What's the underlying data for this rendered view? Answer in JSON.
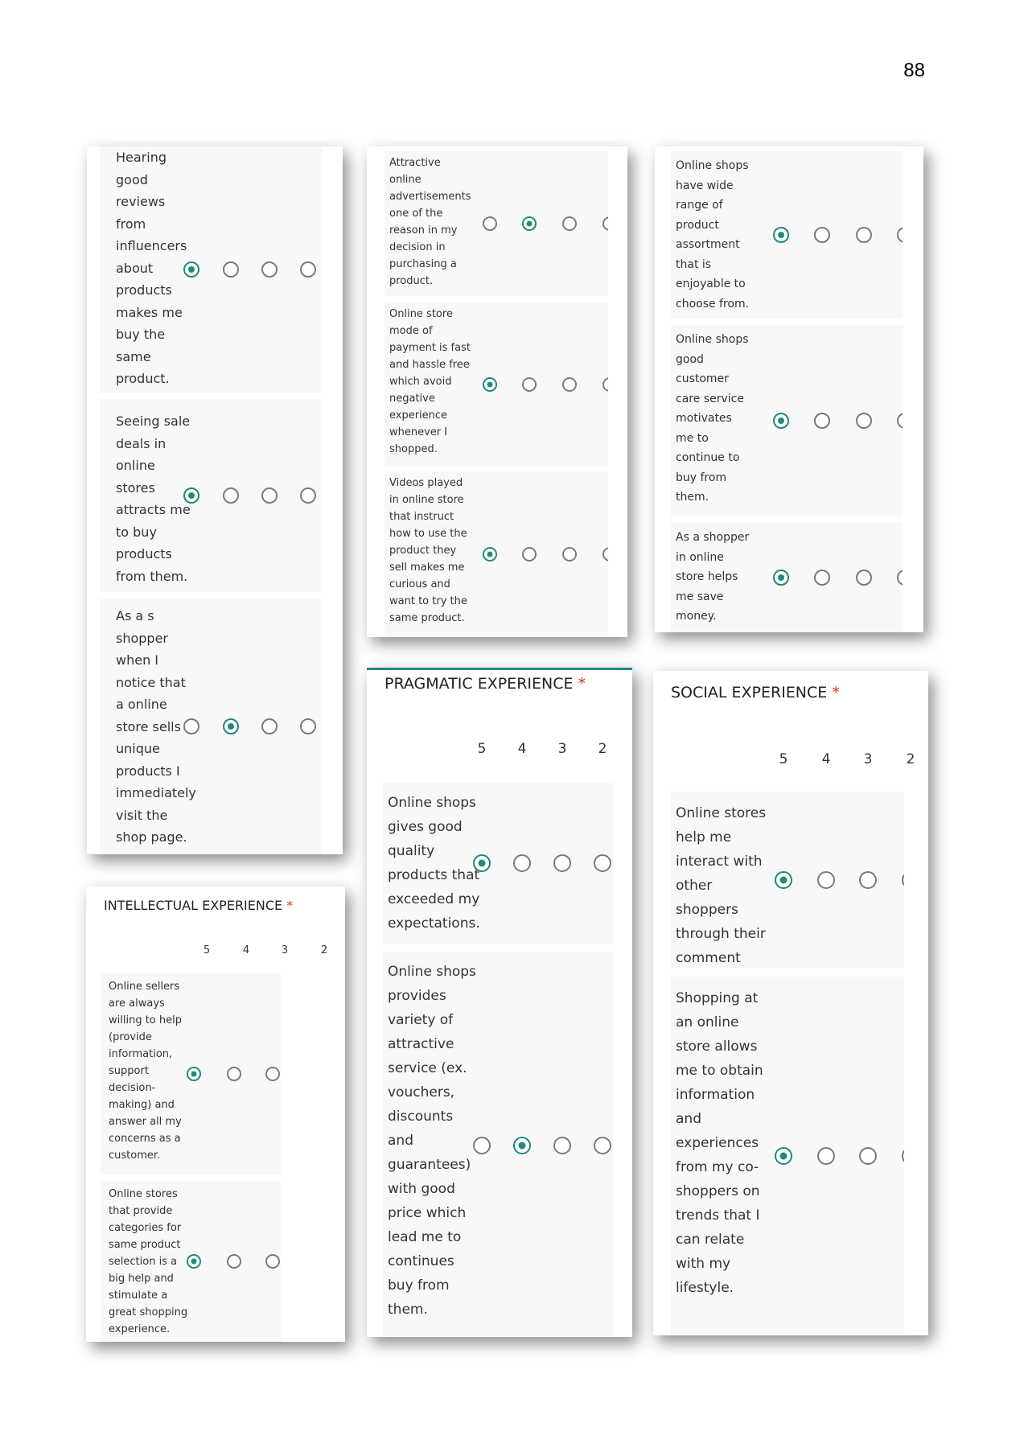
{
  "page_number": "88",
  "required_mark": "*",
  "scale_labels": [
    "5",
    "4",
    "3",
    "2"
  ],
  "sections": {
    "intellectual": {
      "title": "INTELLECTUAL EXPERIENCE"
    },
    "pragmatic": {
      "title": "PRAGMATIC EXPERIENCE"
    },
    "social": {
      "title": "SOCIAL EXPERIENCE"
    }
  },
  "questions": {
    "q1": {
      "text": "Hearing\ngood\nreviews\nfrom\ninfluencers\nabout\nproducts\nmakes me\nbuy the\nsame\nproduct.",
      "selected": "5"
    },
    "q2": {
      "text": "Seeing sale\ndeals in\nonline\nstores\nattracts me\nto buy\nproducts\nfrom them.",
      "selected": "5"
    },
    "q3": {
      "text": "As a s\nshopper\nwhen I\nnotice that\na online\nstore sells a\nunique\nproducts I\nimmediately\nvisit the\nshop page.",
      "selected": "4"
    },
    "q4": {
      "text": "Online sellers\nare always\nwilling to help\n(provide\ninformation,\nsupport\ndecision-\nmaking) and\nanswer all my\nconcerns as a\ncustomer.",
      "selected": "5"
    },
    "q5": {
      "text": "Online stores\nthat provide\ncategories for\nsame product\nselection is a\nbig help and\nstimulate a\ngreat shopping\nexperience.",
      "selected": "5"
    },
    "q6": {
      "text": "Attractive\nonline\nadvertisements\none of the\nreason in my\ndecision in\npurchasing a\nproduct.",
      "selected": "4"
    },
    "q7": {
      "text": "Online store\nmode of\npayment is fast\nand hassle free\nwhich avoid\nnegative\nexperience\nwhenever I\nshopped.",
      "selected": "5"
    },
    "q8": {
      "text": "Videos played\nin online store\nthat instruct\nhow to use the\nproduct they\nsell makes me\ncurious and\nwant to try the\nsame product.",
      "selected": "5"
    },
    "q9": {
      "text": "Online shops\ngives good\nquality\nproducts that\nexceeded my\nexpectations.",
      "selected": "5"
    },
    "q10": {
      "text": "Online shops\nprovides\nvariety of\nattractive\nservice (ex.\nvouchers,\ndiscounts\nand\nguarantees)\nwith good\nprice which\nlead me to\ncontinues\nbuy from\nthem.",
      "selected": "4"
    },
    "q11": {
      "text": "Online shops\nhave wide\nrange of\nproduct\nassortment\nthat is\nenjoyable to\nchoose from.",
      "selected": "5"
    },
    "q12": {
      "text": "Online shops\ngood\ncustomer\ncare service\nmotivates\nme to\ncontinue to\nbuy from\nthem.",
      "selected": "5"
    },
    "q13": {
      "text": "As a shopper\nin online\nstore helps\nme save\nmoney.",
      "selected": "5"
    },
    "q14": {
      "text": "Online stores\nhelp me\ninteract with\nother\nshoppers\nthrough their\ncomment\nsection.",
      "selected": "5"
    },
    "q15": {
      "text": "Shopping at\nan online\nstore allows\nme to obtain\ninformation\nand\nexperiences\nfrom my co-\nshoppers on\ntrends that I\ncan relate\nwith my\nlifestyle.",
      "selected": "5"
    }
  }
}
